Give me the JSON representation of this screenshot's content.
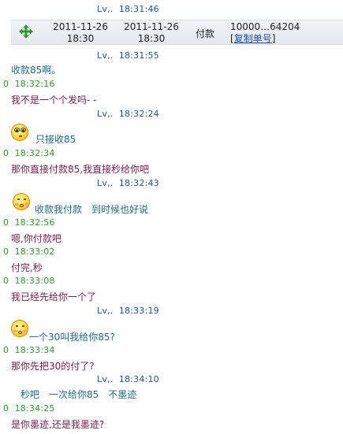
{
  "chat": {
    "top_header": {
      "sender": "Lv,.",
      "time": "18:31:46"
    },
    "order_card": {
      "created_date": "2011-11-26",
      "created_time": "18:30",
      "paid_date": "2011-11-26",
      "paid_time": "18:30",
      "status": "付款",
      "order_no": "10000…64204",
      "copy_bracket_open": "[",
      "copy_label": "复制单号",
      "copy_bracket_close": "]"
    },
    "messages": [
      {
        "side": "right",
        "sender": "Lv,.",
        "time": "18:31:55",
        "text": "收款85啊。",
        "emoji": null
      },
      {
        "side": "left",
        "sender": "0",
        "time": "18:32:16",
        "text": "我不是一个个发吗- -",
        "emoji": null
      },
      {
        "side": "right",
        "sender": "Lv,.",
        "time": "18:32:24",
        "text": "只接收85",
        "emoji": "thinking-glasses"
      },
      {
        "side": "left",
        "sender": "0",
        "time": "18:32:34",
        "text": "那你直接付款85,我直接秒给你吧",
        "emoji": null
      },
      {
        "side": "right",
        "sender": "Lv,.",
        "time": "18:32:43",
        "text": "收款我付款　到时候也好说",
        "emoji": "kiss-face"
      },
      {
        "side": "left",
        "sender": "0",
        "time": "18:32:56",
        "text": "嗯,你付款吧",
        "emoji": null
      },
      {
        "side": "left",
        "sender": "0",
        "time": "18:33:02",
        "text": "付完,秒",
        "emoji": null
      },
      {
        "side": "left",
        "sender": "0",
        "time": "18:33:08",
        "text": "我已经先给你一个了",
        "emoji": null
      },
      {
        "side": "right",
        "sender": "Lv,.",
        "time": "18:33:19",
        "text": "一个30叫我给你85?",
        "emoji": "kiss-face"
      },
      {
        "side": "left",
        "sender": "0",
        "time": "18:33:34",
        "text": "那你先把30的付了?",
        "emoji": null
      },
      {
        "side": "right",
        "sender": "Lv,.",
        "time": "18:34:10",
        "text": "秒吧　一次给你85　不墨迹",
        "emoji": null
      },
      {
        "side": "left",
        "sender": "0",
        "time": "18:34:25",
        "text": "是你墨迹,还是我墨迹?",
        "emoji": null
      }
    ]
  },
  "colors": {
    "right_header": "#1f4f9a",
    "left_header": "#2a9a2a",
    "left_message": "#7a1a4a",
    "right_message": "#1f6a8a",
    "link": "#1d4fb8",
    "move_icon": "#2f9a2f"
  }
}
